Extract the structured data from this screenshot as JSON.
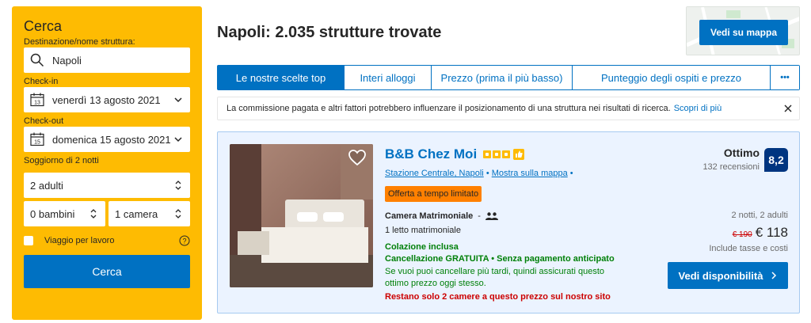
{
  "search": {
    "title": "Cerca",
    "destination_label": "Destinazione/nome struttura:",
    "destination_value": "Napoli",
    "checkin_label": "Check-in",
    "checkin_value": "venerdì 13 agosto 2021",
    "checkin_day": "13",
    "checkout_label": "Check-out",
    "checkout_value": "domenica 15 agosto 2021",
    "checkout_day": "15",
    "stay_label": "Soggiorno di 2 notti",
    "adults_value": "2 adulti",
    "children_value": "0 bambini",
    "rooms_value": "1 camera",
    "business_label": "Viaggio per lavoro",
    "search_button": "Cerca"
  },
  "header": {
    "title": "Napoli: 2.035 strutture trovate",
    "map_button": "Vedi su mappa"
  },
  "tabs": [
    {
      "label": "Le nostre scelte top",
      "active": true
    },
    {
      "label": "Interi alloggi",
      "active": false
    },
    {
      "label": "Prezzo (prima il più basso)",
      "active": false
    },
    {
      "label": "Punteggio degli ospiti e prezzo",
      "active": false
    },
    {
      "label": "•••",
      "active": false
    }
  ],
  "notice": {
    "text": "La commissione pagata e altri fattori potrebbero influenzare il posizionamento di una struttura nei risultati di ricerca.",
    "link": "Scopri di più"
  },
  "property": {
    "name": "B&B Chez Moi",
    "stars": 3,
    "location": "Stazione Centrale, Napoli",
    "map_link": "Mostra sulla mappa",
    "deal_badge": "Offerta a tempo limitato",
    "room_name": "Camera Matrimoniale",
    "room_dash": "-",
    "bed": "1 letto matrimoniale",
    "breakfast": "Colazione inclusa",
    "cancellation": "Cancellazione GRATUITA • Senza pagamento anticipato",
    "cancellation_desc": "Se vuoi puoi cancellare più tardi, quindi assicurati questo ottimo prezzo oggi stesso.",
    "scarcity": "Restano solo 2 camere a questo prezzo sul nostro sito",
    "rating_word": "Ottimo",
    "reviews": "132 recensioni",
    "score": "8,2",
    "stay_length": "2 notti, 2 adulti",
    "old_price": "€ 190",
    "new_price": "€ 118",
    "taxes": "Include tasse e costi",
    "availability_button": "Vedi disponibilità"
  },
  "colors": {
    "brand_yellow": "#febb02",
    "brand_blue": "#0071c2",
    "score_navy": "#003580",
    "deal_orange": "#ff8000",
    "green": "#008009",
    "red": "#cc0000"
  }
}
